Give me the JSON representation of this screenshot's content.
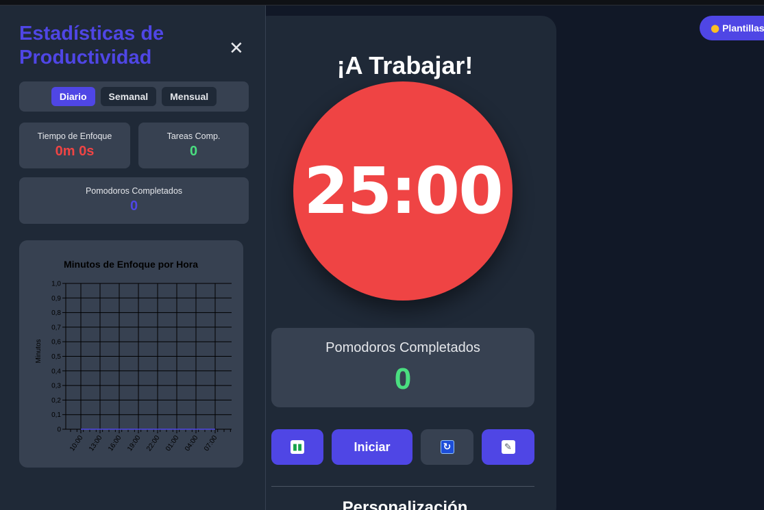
{
  "main": {
    "title": "¡A Trabajar!",
    "timer": "25:00",
    "timer_color": "#ef4444",
    "pomodoros_label": "Pomodoros Completados",
    "pomodoros_value": "0",
    "buttons": {
      "stats_icon": "bar-chart-icon",
      "start_label": "Iniciar",
      "reset_icon": "refresh-icon",
      "notes_icon": "memo-icon"
    },
    "section_title": "Personalización"
  },
  "templates_button": {
    "icon": "palette-icon",
    "label": "Plantillas"
  },
  "sidebar": {
    "title": "Estadísticas de Productividad",
    "tabs": [
      "Diario",
      "Semanal",
      "Mensual"
    ],
    "active_tab": "Diario",
    "stats": {
      "focus_time_label": "Tiempo de Enfoque",
      "focus_time_value": "0m 0s",
      "tasks_label": "Tareas Comp.",
      "tasks_value": "0",
      "pomodoros_label": "Pomodoros Completados",
      "pomodoros_value": "0"
    }
  },
  "colors": {
    "accent": "#4f46e5",
    "timer_red": "#ef4444",
    "success_green": "#4ade80",
    "card_bg": "#374151",
    "panel_bg": "#1f2937",
    "page_bg": "#111827"
  },
  "chart_data": {
    "type": "line",
    "title": "Minutos de Enfoque por Hora",
    "xlabel": "",
    "ylabel": "Minutos",
    "ylim": [
      0,
      1.0
    ],
    "yticks": [
      "0",
      "0,1",
      "0,2",
      "0,3",
      "0,4",
      "0,5",
      "0,6",
      "0,7",
      "0,8",
      "0,9",
      "1,0"
    ],
    "categories": [
      "10:00",
      "13:00",
      "16:00",
      "19:00",
      "22:00",
      "01:00",
      "04:00",
      "07:00"
    ],
    "series": [
      {
        "values": [
          0,
          0,
          0,
          0,
          0,
          0,
          0,
          0
        ]
      }
    ],
    "grid": true
  }
}
